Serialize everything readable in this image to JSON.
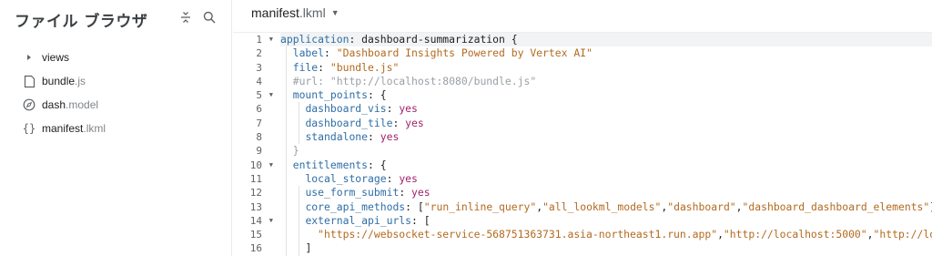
{
  "sidebar": {
    "title": "ファイル ブラウザ",
    "items": [
      {
        "name": "views",
        "ext": "",
        "icon": "chevron-right-icon"
      },
      {
        "name": "bundle",
        "ext": ".js",
        "icon": "file-icon"
      },
      {
        "name": "dash",
        "ext": ".model",
        "icon": "compass-icon"
      },
      {
        "name": "manifest",
        "ext": ".lkml",
        "icon": "braces-icon"
      }
    ]
  },
  "editor": {
    "file_name": "manifest",
    "file_ext": ".lkml",
    "line_numbers": [
      "1",
      "2",
      "3",
      "4",
      "5",
      "6",
      "7",
      "8",
      "9",
      "10",
      "11",
      "12",
      "13",
      "14",
      "15",
      "16"
    ],
    "lines": {
      "l1_key": "application",
      "l1_rest": ": dashboard-summarization {",
      "l2_key": "label",
      "l2_val": "\"Dashboard Insights Powered by Vertex AI\"",
      "l3_key": "file",
      "l3_val": "\"bundle.js\"",
      "l4_comment": "#url: \"http://localhost:8080/bundle.js\"",
      "l5_key": "mount_points",
      "l5_rest": ": {",
      "l6_key": "dashboard_vis",
      "l6_val": "yes",
      "l7_key": "dashboard_tile",
      "l7_val": "yes",
      "l8_key": "standalone",
      "l8_val": "yes",
      "l9": "}",
      "l10_key": "entitlements",
      "l10_rest": ": {",
      "l11_key": "local_storage",
      "l11_val": "yes",
      "l12_key": "use_form_submit",
      "l12_val": "yes",
      "l13_key": "core_api_methods",
      "l13_open": ": [",
      "l13_s1": "\"run_inline_query\"",
      "l13_s2": "\"all_lookml_models\"",
      "l13_s3": "\"dashboard\"",
      "l13_s4": "\"dashboard_dashboard_elements\"",
      "l13_close": "]",
      "l14_key": "external_api_urls",
      "l14_rest": ": [",
      "l15_s1": "\"https://websocket-service-568751363731.asia-northeast1.run.app\"",
      "l15_s2": "\"http://localhost:5000\"",
      "l15_s3": "\"http://loc",
      "l16": "]"
    }
  },
  "colors": {
    "key": "#2f6ea6",
    "string": "#b36a1f",
    "boolean": "#a0236d",
    "comment": "#9aa0a6"
  }
}
